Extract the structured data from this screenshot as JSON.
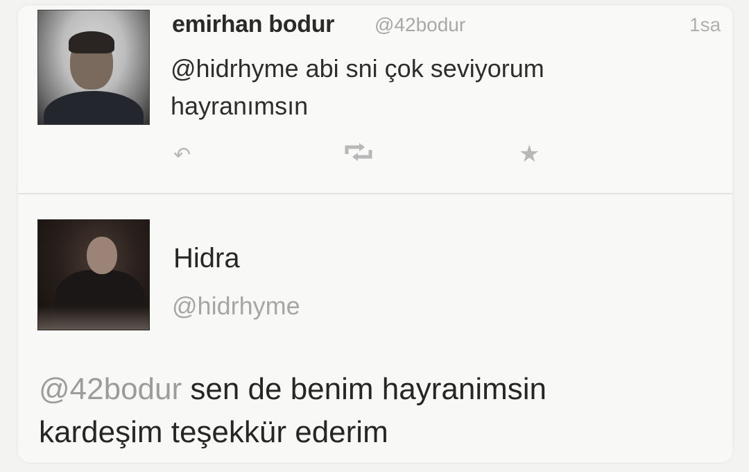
{
  "tweets": [
    {
      "author_name": "emirhan bodur",
      "author_handle": "@42bodur",
      "timestamp": "1sa",
      "text_line1": "@hidrhyme  abi sni çok seviyorum",
      "text_line2": "hayranımsın",
      "actions": {
        "reply_icon": "reply-icon",
        "retweet_icon": "retweet-icon",
        "favorite_icon": "star-icon"
      }
    },
    {
      "author_name": "Hidra",
      "author_handle": "@hidrhyme",
      "mention": "@42bodur",
      "text_line1_rest": " sen de benim hayranimsin",
      "text_line2": "kardeşim teşekkür ederim"
    }
  ],
  "colors": {
    "background": "#f3f3f1",
    "primary_text": "#262626",
    "secondary_text": "#a6a6a6",
    "icon": "#b8b8b8"
  }
}
